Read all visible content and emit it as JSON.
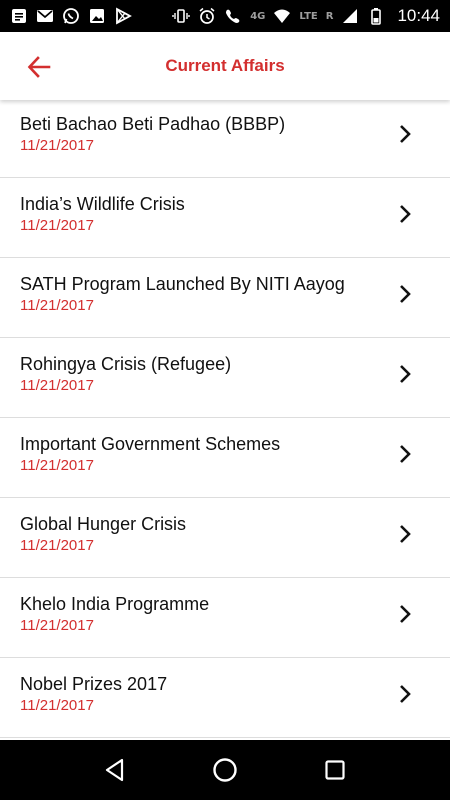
{
  "status_bar": {
    "network_label": "LTE",
    "signal_label_4g": "4G",
    "roaming_label": "R",
    "time": "10:44",
    "left_icons": [
      "notification-icon",
      "gmail-icon",
      "whatsapp-icon",
      "gallery-icon",
      "play-store-icon"
    ],
    "right_icons": [
      "vibrate-icon",
      "alarm-icon",
      "phone-4g-icon",
      "wifi-icon",
      "signal-icon",
      "battery-icon"
    ]
  },
  "app_bar": {
    "title": "Current Affairs",
    "back_icon": "arrow-left-icon",
    "accent_color": "#d32f2f"
  },
  "list": {
    "items": [
      {
        "title": "Beti Bachao Beti Padhao (BBBP)",
        "date": "11/21/2017"
      },
      {
        "title": "India’s Wildlife Crisis",
        "date": "11/21/2017"
      },
      {
        "title": "SATH Program Launched By NITI Aayog",
        "date": "11/21/2017"
      },
      {
        "title": "Rohingya Crisis (Refugee)",
        "date": "11/21/2017"
      },
      {
        "title": "Important Government Schemes",
        "date": "11/21/2017"
      },
      {
        "title": "Global Hunger Crisis",
        "date": "11/21/2017"
      },
      {
        "title": "Khelo India Programme",
        "date": "11/21/2017"
      },
      {
        "title": "Nobel Prizes 2017",
        "date": "11/21/2017"
      }
    ]
  },
  "nav_bar": {
    "buttons": [
      "back-triangle-icon",
      "home-circle-icon",
      "recents-square-icon"
    ]
  }
}
